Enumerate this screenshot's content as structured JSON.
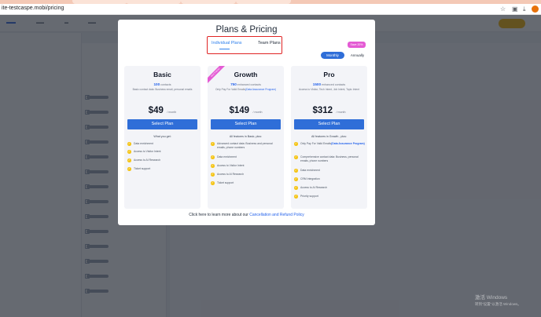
{
  "browser": {
    "url": "ite-testcaspe.mobi/pricing",
    "colors": {
      "tab_strip": "#f4c9b6",
      "profile": "#e8710a"
    }
  },
  "modal": {
    "title": "Plans & Pricing",
    "tabs": {
      "individual": "Individual Plans",
      "team": "Team Plans",
      "active": "individual"
    },
    "billing": {
      "monthly": "Monthly",
      "annually": "Annually",
      "active": "monthly",
      "save_badge": "Save 20%"
    },
    "select_label": "Select Plan",
    "plans": [
      {
        "name": "Basic",
        "contacts_number": "100",
        "contacts_label": "contacts",
        "description": "Basic contact data: Business email, personal emails",
        "price": "$49",
        "period": "/ month",
        "features_title": "What you get:",
        "features": [
          "Data enrichment",
          "Access to Visitor Intent",
          "Access to AI Research",
          "Ticket support"
        ]
      },
      {
        "name": "Growth",
        "ribbon": "Most Popular",
        "contacts_number": "750",
        "contacts_label": "enhanced contacts",
        "description_pre": "Only Pay For Valid Emails",
        "description_link": "(Data Assurance Program)",
        "price": "$149",
        "period": "/ month",
        "features_title": "All features in Basic, plus:",
        "features": [
          "Advanced contact data: Business and personal emails, phone numbers",
          "Data enrichment",
          "Access to Visitor Intent",
          "Access to AI Research",
          "Ticket support"
        ]
      },
      {
        "name": "Pro",
        "contacts_number": "1500",
        "contacts_label": "enhanced contacts",
        "description": "Access to Visitor, Tech Intent, Job Intent, Topic Intent",
        "price": "$312",
        "period": "/ month",
        "features_title": "All features in Growth , plus:",
        "first_feature_pre": "Only Pay For Valid Emails",
        "first_feature_link": "(Data Assurance Program)",
        "features": [
          "Comprehensive contact data: Business, personal emails, phone numbers",
          "Data enrichment",
          "CRM Integration",
          "Access to AI Research",
          "Priority support"
        ]
      }
    ],
    "footer_pre": "Click here to learn more about our",
    "footer_link": "Cancellation and Refund Policy",
    "colors": {
      "primary": "#2f6ed8",
      "highlight_border": "#e02424",
      "ribbon": "#e45bd4",
      "check": "#f5c518"
    }
  },
  "watermark": {
    "line1": "激活 Windows",
    "line2": "转到\"设置\"以激活 Windows。"
  }
}
